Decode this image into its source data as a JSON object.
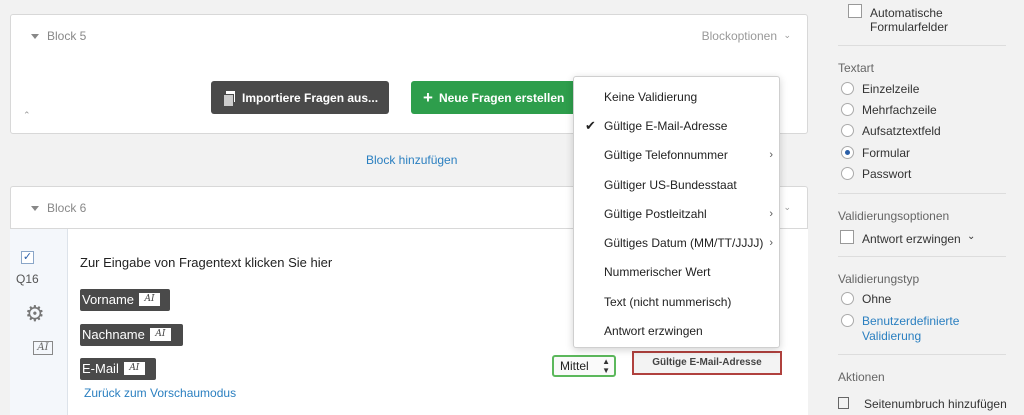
{
  "block5": {
    "title": "Block 5",
    "options_label": "Blockoptionen",
    "import_button": "Importiere Fragen aus...",
    "new_button": "Neue Fragen erstellen"
  },
  "add_block_link": "Block hinzufügen",
  "block6": {
    "title": "Block 6"
  },
  "question": {
    "id": "Q16",
    "text": "Zur Eingabe von Fragentext klicken Sie hier",
    "fields": [
      "Vorname",
      "Nachname",
      "E-Mail"
    ],
    "field_icon": "AI",
    "back_link": "Zurück zum Vorschaumodus",
    "size_select": "Mittel",
    "validation_button": "Gültige E-Mail-Adresse"
  },
  "dropdown": {
    "items": [
      {
        "label": "Keine Validierung",
        "checked": false,
        "submenu": false
      },
      {
        "label": "Gültige E-Mail-Adresse",
        "checked": true,
        "submenu": false
      },
      {
        "label": "Gültige Telefonnummer",
        "checked": false,
        "submenu": true
      },
      {
        "label": "Gültiger US-Bundesstaat",
        "checked": false,
        "submenu": false
      },
      {
        "label": "Gültige Postleitzahl",
        "checked": false,
        "submenu": true
      },
      {
        "label": "Gültiges Datum (MM/TT/JJJJ)",
        "checked": false,
        "submenu": true
      },
      {
        "label": "Nummerischer Wert",
        "checked": false,
        "submenu": false
      },
      {
        "label": "Text (nicht nummerisch)",
        "checked": false,
        "submenu": false
      },
      {
        "label": "Antwort erzwingen",
        "checked": false,
        "submenu": false
      }
    ]
  },
  "sidebar": {
    "auto_fields_line1": "Automatische",
    "auto_fields_line2": "Formularfelder",
    "textart_heading": "Textart",
    "textart_options": [
      "Einzelzeile",
      "Mehrfachzeile",
      "Aufsatztextfeld",
      "Formular",
      "Passwort"
    ],
    "textart_selected": "Formular",
    "validation_options_heading": "Validierungsoptionen",
    "force_response": "Antwort erzwingen",
    "validation_type_heading": "Validierungstyp",
    "validation_none": "Ohne",
    "validation_custom_line1": "Benutzerdefinierte",
    "validation_custom_line2": "Validierung",
    "actions_heading": "Aktionen",
    "page_break": "Seitenumbruch hinzufügen"
  },
  "colors": {
    "primary_green": "#2e9e4c",
    "link_blue": "#2a7fc0",
    "highlight_red": "#b0413e"
  }
}
